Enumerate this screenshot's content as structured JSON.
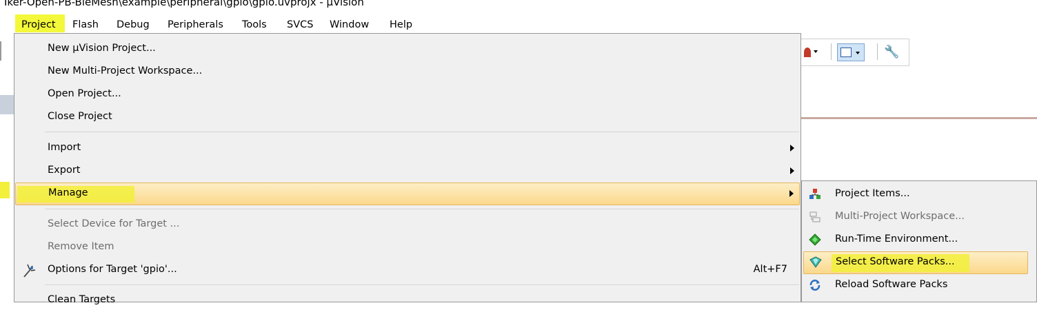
{
  "window": {
    "title": "Iker-Open-PB-BleMesh\\example\\peripheral\\gpio\\gpio.uvprojx - µVision"
  },
  "menubar": {
    "items": [
      "Project",
      "Flash",
      "Debug",
      "Peripherals",
      "Tools",
      "SVCS",
      "Window",
      "Help"
    ],
    "active": "Project"
  },
  "project_menu": {
    "items": [
      {
        "label": "New µVision Project...",
        "enabled": true
      },
      {
        "label": "New Multi-Project Workspace...",
        "enabled": true
      },
      {
        "label": "Open Project...",
        "enabled": true
      },
      {
        "label": "Close Project",
        "enabled": true
      },
      {
        "label": "Import",
        "enabled": true,
        "submenu": true
      },
      {
        "label": "Export",
        "enabled": true,
        "submenu": true
      },
      {
        "label": "Manage",
        "enabled": true,
        "submenu": true,
        "highlighted": true
      },
      {
        "label": "Select Device for Target ...",
        "enabled": false
      },
      {
        "label": "Remove Item",
        "enabled": false
      },
      {
        "label": "Options for Target 'gpio'...",
        "enabled": true,
        "shortcut": "Alt+F7",
        "icon": "target-options-icon"
      },
      {
        "label": "Clean Targets",
        "enabled": true
      }
    ]
  },
  "manage_submenu": {
    "items": [
      {
        "label": "Project Items...",
        "enabled": true,
        "icon": "project-items-icon"
      },
      {
        "label": "Multi-Project Workspace...",
        "enabled": false,
        "icon": "multi-project-icon"
      },
      {
        "label": "Run-Time Environment...",
        "enabled": true,
        "icon": "rte-icon"
      },
      {
        "label": "Select Software Packs...",
        "enabled": true,
        "icon": "software-packs-icon",
        "highlighted": true
      },
      {
        "label": "Reload Software Packs",
        "enabled": true,
        "icon": "reload-icon"
      }
    ]
  },
  "colors": {
    "highlight_marker": "#f2f03a",
    "hover": "#fbd88c",
    "menu_bg": "#f0f0f0"
  }
}
